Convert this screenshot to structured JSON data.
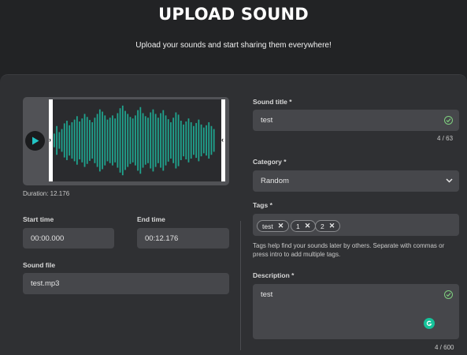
{
  "header": {
    "title": "UPLOAD SOUND",
    "subtitle": "Upload your sounds and start sharing them everywhere!"
  },
  "waveform": {
    "duration_text": "Duration: 12.176",
    "bar_color": "#1fa58f",
    "play_color": "#22c4c4",
    "bars": [
      0.18,
      0.38,
      0.22,
      0.3,
      0.45,
      0.52,
      0.4,
      0.48,
      0.55,
      0.64,
      0.5,
      0.58,
      0.7,
      0.62,
      0.54,
      0.48,
      0.6,
      0.7,
      0.82,
      0.76,
      0.66,
      0.55,
      0.6,
      0.66,
      0.58,
      0.72,
      0.85,
      0.92,
      0.78,
      0.7,
      0.62,
      0.58,
      0.66,
      0.8,
      0.88,
      0.72,
      0.64,
      0.6,
      0.74,
      0.82,
      0.7,
      0.6,
      0.72,
      0.8,
      0.66,
      0.56,
      0.48,
      0.6,
      0.74,
      0.68,
      0.52,
      0.42,
      0.5,
      0.58,
      0.48,
      0.38,
      0.46,
      0.55,
      0.42,
      0.34,
      0.4,
      0.48,
      0.38,
      0.3
    ]
  },
  "trim": {
    "start_label": "Start time",
    "start_value": "00:00.000",
    "end_label": "End time",
    "end_value": "00:12.176"
  },
  "sound_file": {
    "label": "Sound file",
    "value": "test.mp3"
  },
  "title_field": {
    "label": "Sound title *",
    "value": "test",
    "counter": "4 / 63"
  },
  "category": {
    "label": "Category *",
    "value": "Random"
  },
  "tags": {
    "label": "Tags *",
    "items": [
      "test",
      "1",
      "2"
    ],
    "help": "Tags help find your sounds later by others. Separate with commas or press intro to add multiple tags."
  },
  "description": {
    "label": "Description *",
    "value": "test",
    "counter": "4 / 600"
  },
  "colors": {
    "valid_check": "#7fd07f",
    "grammarly": "#15c39a"
  }
}
